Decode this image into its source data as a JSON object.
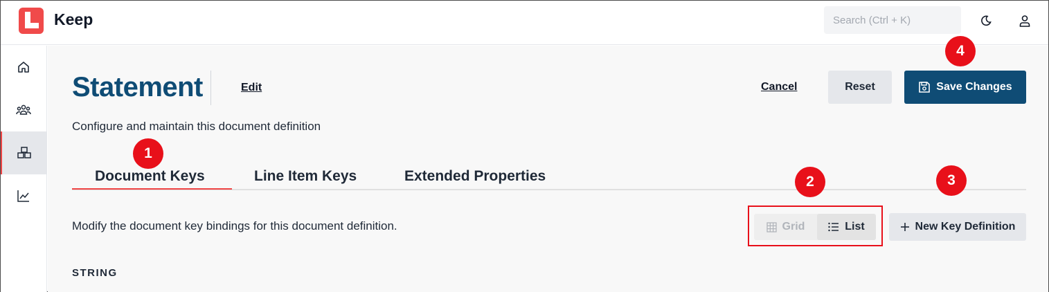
{
  "app": {
    "name": "Keep"
  },
  "search": {
    "placeholder": "Search (Ctrl + K)"
  },
  "header_icons": [
    "moon-icon",
    "user-icon"
  ],
  "sidebar": {
    "items": [
      {
        "icon": "home-icon",
        "active": false
      },
      {
        "icon": "users-icon",
        "active": false
      },
      {
        "icon": "boxes-icon",
        "active": true
      },
      {
        "icon": "chart-line-icon",
        "active": false
      }
    ]
  },
  "page": {
    "title": "Statement",
    "edit_label": "Edit",
    "subtitle": "Configure and maintain this document definition",
    "cancel_label": "Cancel",
    "reset_label": "Reset",
    "save_label": "Save Changes"
  },
  "tabs": [
    {
      "label": "Document Keys",
      "active": true
    },
    {
      "label": "Line Item Keys",
      "active": false
    },
    {
      "label": "Extended Properties",
      "active": false
    }
  ],
  "tab_content": {
    "description": "Modify the document key bindings for this document definition.",
    "view_toggle": {
      "grid_label": "Grid",
      "list_label": "List",
      "selected": "List"
    },
    "new_key_label": "New Key Definition",
    "section_label": "STRING"
  },
  "annotations": {
    "callouts": [
      "1",
      "2",
      "3",
      "4"
    ],
    "color": "#e8101a"
  },
  "colors": {
    "brand": "#0f4c75",
    "accent": "#ef4444",
    "logo": "#f04a4a"
  }
}
